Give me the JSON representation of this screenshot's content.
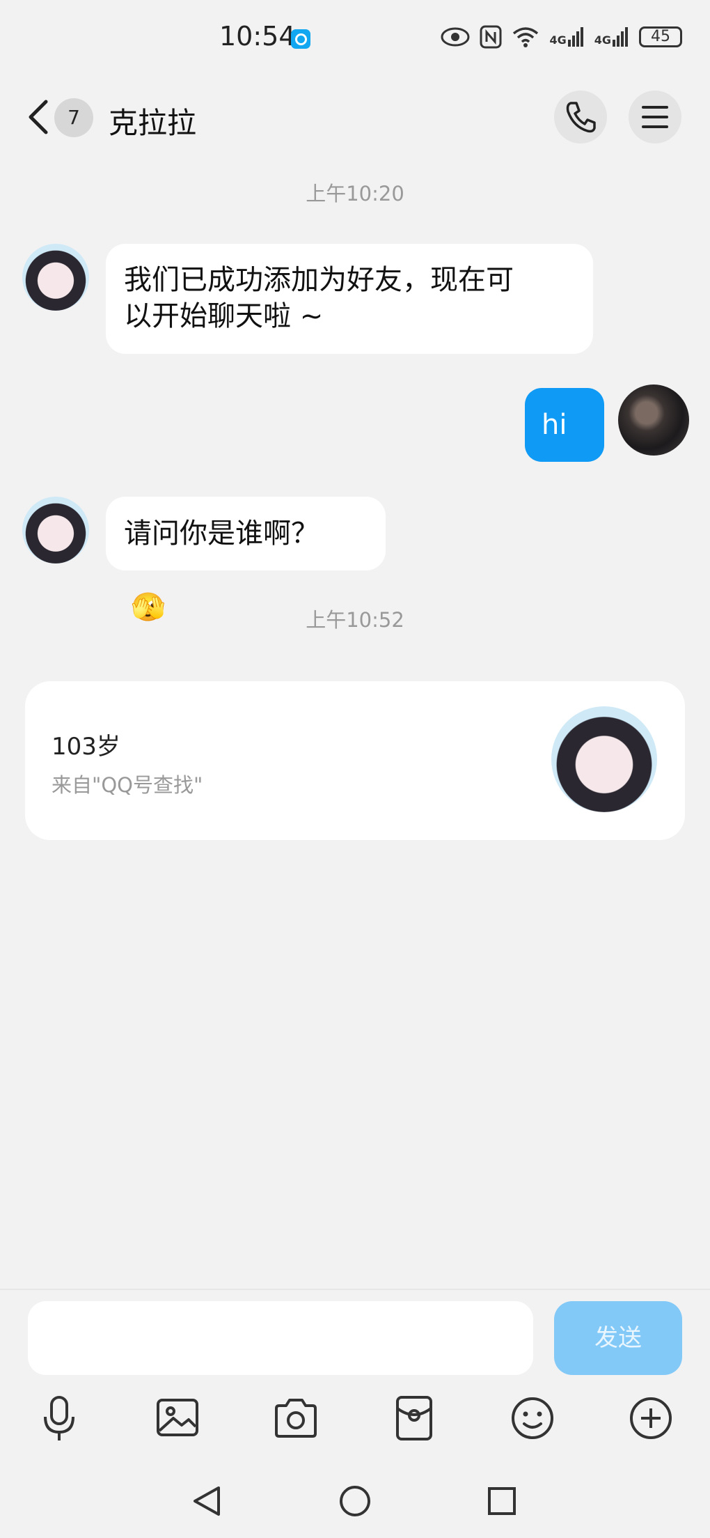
{
  "status_bar": {
    "time": "10:54",
    "network_1": "4G",
    "network_2": "4G",
    "battery": "45"
  },
  "header": {
    "unread_count": "7",
    "contact_name": "克拉拉"
  },
  "messages": [
    {
      "type": "timestamp",
      "text": "上午10:20"
    },
    {
      "type": "received",
      "text_line1": "我们已成功添加为好友，现在可",
      "text_line2": "以开始聊天啦 ~"
    },
    {
      "type": "sent",
      "text": "hi"
    },
    {
      "type": "received",
      "text": "请问你是谁啊？",
      "emoji": "🫣"
    },
    {
      "type": "timestamp",
      "text": "上午10:52"
    }
  ],
  "profile_card": {
    "age": "103岁",
    "source": "来自\"QQ号查找\""
  },
  "composer": {
    "placeholder": "",
    "send_label": "发送"
  },
  "toolbar_icons": [
    "microphone-icon",
    "image-icon",
    "camera-icon",
    "red-packet-icon",
    "emoji-icon",
    "plus-icon"
  ],
  "colors": {
    "background": "#f2f2f2",
    "sent_bubble": "#0f9bf5",
    "send_button": "#82c9f8"
  }
}
